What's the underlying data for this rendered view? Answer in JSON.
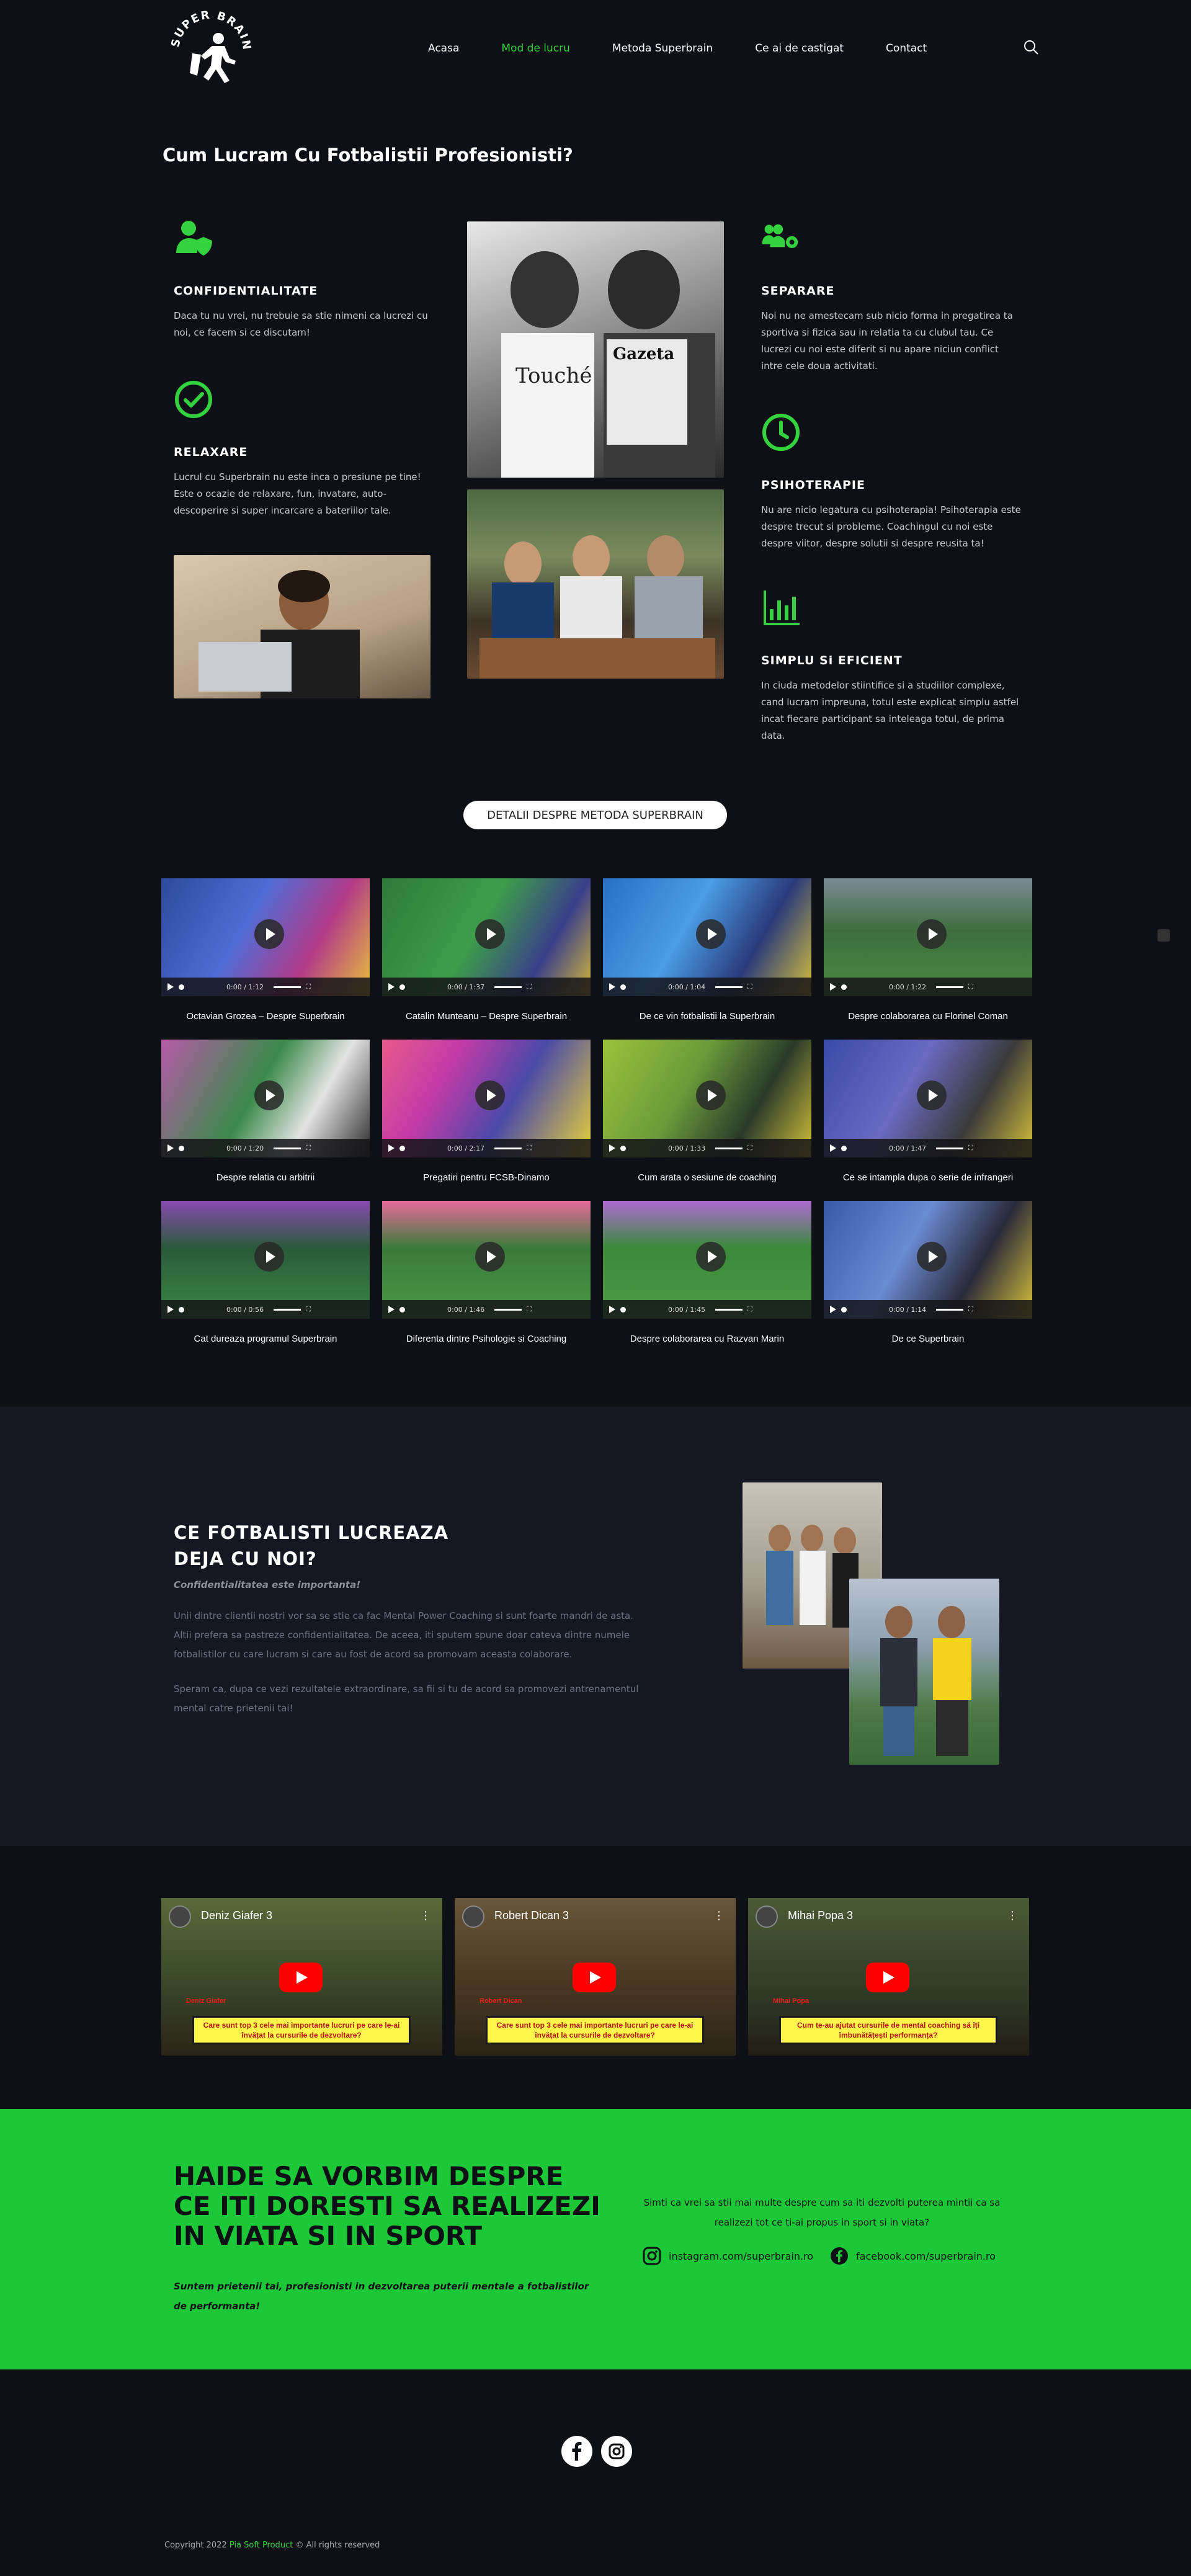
{
  "nav": {
    "items": [
      "Acasa",
      "Mod de lucru",
      "Metoda Superbrain",
      "Ce ai de castigat",
      "Contact"
    ],
    "active_index": 1
  },
  "logo": {
    "text": "SUPER BRAIN"
  },
  "section_title": "Cum Lucram Cu Fotbalistii Profesionisti?",
  "features": {
    "confidentialitate": {
      "title": "CONFIDENTIALITATE",
      "text": "Daca tu nu vrei, nu trebuie sa stie nimeni ca lucrezi cu noi, ce facem si ce discutam!"
    },
    "relaxare": {
      "title": "RELAXARE",
      "text": "Lucrul cu Superbrain nu este inca o presiune pe tine! Este o ocazie de relaxare, fun, invatare, auto-descoperire si super incarcare a bateriilor tale."
    },
    "separare": {
      "title": "SEPARARE",
      "text": "Noi nu ne amestecam sub nicio forma in pregatirea ta sportiva si fizica sau in relatia ta cu clubul tau. Ce lucrezi cu noi este diferit si nu apare niciun conflict intre cele doua activitati."
    },
    "psihoterapie": {
      "title": "PSIHOTERAPIE",
      "text": "Nu are nicio legatura cu psihoterapia! Psihoterapia este despre trecut si probleme. Coachingul cu noi este despre viitor, despre solutii si despre reusita ta!"
    },
    "simplu": {
      "title": "SIMPLU Si EFICIENT",
      "text": "In ciuda metodelor stiintifice si a studiilor complexe, cand lucram impreuna, totul este explicat simplu astfel incat fiecare participant sa inteleaga totul, de prima data."
    }
  },
  "detail_button": "DETALII DESPRE METODA SUPERBRAIN",
  "videos": [
    {
      "caption": "Octavian Grozea – Despre Superbrain",
      "time": "0:00 / 1:12"
    },
    {
      "caption": "Catalin Munteanu – Despre Superbrain",
      "time": "0:00 / 1:37"
    },
    {
      "caption": "De ce vin fotbalistii la Superbrain",
      "time": "0:00 / 1:04"
    },
    {
      "caption": "Despre colaborarea cu Florinel Coman",
      "time": "0:00 / 1:22"
    },
    {
      "caption": "Despre relatia cu arbitrii",
      "time": "0:00 / 1:20"
    },
    {
      "caption": "Pregatiri pentru FCSB-Dinamo",
      "time": "0:00 / 2:17"
    },
    {
      "caption": "Cum arata o sesiune de coaching",
      "time": "0:00 / 1:33"
    },
    {
      "caption": "Ce se intampla dupa o serie de infrangeri",
      "time": "0:00 / 1:47"
    },
    {
      "caption": "Cat dureaza programul Superbrain",
      "time": "0:00 / 0:56"
    },
    {
      "caption": "Diferenta dintre Psihologie si Coaching",
      "time": "0:00 / 1:46"
    },
    {
      "caption": "Despre colaborarea cu Razvan Marin",
      "time": "0:00 / 1:45"
    },
    {
      "caption": "De ce Superbrain",
      "time": "0:00 / 1:14"
    }
  ],
  "players": {
    "title": "CE FOTBALISTI LUCREAZA DEJA CU NOI?",
    "subtitle": "Confidentialitatea este importanta!",
    "p1": "Unii dintre clientii nostri vor sa se stie ca fac Mental Power Coaching si sunt foarte mandri de asta. Altii prefera sa pastreze confidentialitatea. De aceea, iti sputem spune doar cateva dintre numele fotbalistilor cu care lucram si care au fost de acord sa promovam aceasta colaborare.",
    "p2": "Speram ca, dupa ce vezi rezultatele extraordinare, sa fii si tu de acord sa promovezi antrenamentul mental catre prietenii tai!"
  },
  "youtube": [
    {
      "name": "Deniz Giafer 3",
      "red": "Deniz Giafer",
      "banner": "Care sunt top 3 cele mai importante lucruri pe care le-ai învățat la cursurile de dezvoltare?"
    },
    {
      "name": "Robert Dican 3",
      "red": "Robert Dican",
      "banner": "Care sunt top 3 cele mai importante lucruri pe care le-ai învățat la cursurile de dezvoltare?"
    },
    {
      "name": "Mihai Popa 3",
      "red": "Mihai Popa",
      "banner": "Cum te-au ajutat cursurile de mental coaching să îți îmbunătățești performanța?"
    }
  ],
  "cta": {
    "title": "HAIDE SA VORBIM DESPRE CE ITI DORESTI SA REALIZEZI IN VIATA SI IN SPORT",
    "subtitle": "Suntem prietenii tai, profesionisti in dezvoltarea puterii mentale a fotbalistilor de performanta!",
    "right_text": "Simti ca vrei sa stii mai multe despre cum sa iti dezvolti puterea mintii ca sa realizezi tot ce ti-ai propus in sport si in viata?",
    "instagram": "instagram.com/superbrain.ro",
    "facebook": "facebook.com/superbrain.ro"
  },
  "footer": {
    "copyright_prefix": "Copyright 2022",
    "brand": "Pia Soft Product",
    "copyright_suffix": "© All rights reserved"
  },
  "colors": {
    "accent": "#35d23f",
    "cta_bg": "#1cc838",
    "page_bg": "#0e1016"
  }
}
